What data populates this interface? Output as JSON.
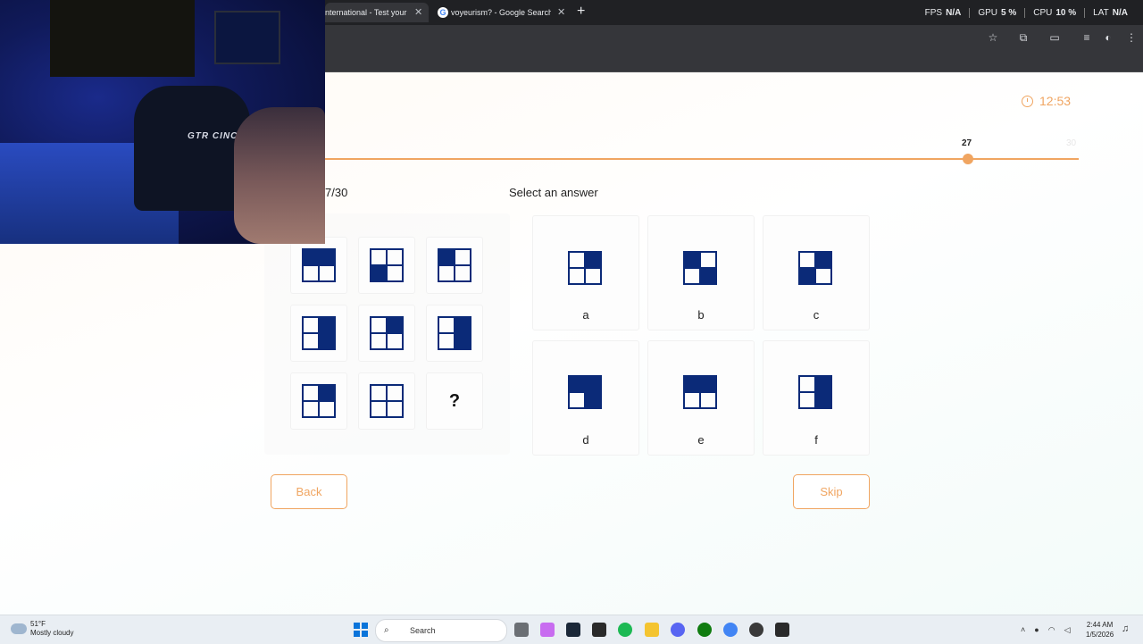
{
  "browser": {
    "tabs": [
      {
        "label": "nternational - Test your Inte",
        "active": true
      },
      {
        "label": "voyeurism? - Google Search",
        "active": false
      }
    ],
    "close_glyph": "✕",
    "new_tab_glyph": "+",
    "google_glyph": "G",
    "perf": [
      {
        "label": "FPS",
        "value": "N/A"
      },
      {
        "label": "GPU",
        "value": "5 %"
      },
      {
        "label": "CPU",
        "value": "10 %"
      },
      {
        "label": "LAT",
        "value": "N/A"
      }
    ],
    "toolbar_icons": [
      "star-icon",
      "extensions-icon",
      "cast-icon",
      "media-control-icon",
      "profile-icon",
      "more-icon"
    ]
  },
  "webcam": {
    "brand": "GTR CINC"
  },
  "quiz": {
    "timer": "12:53",
    "progress": {
      "current": "27",
      "total": "30",
      "fraction": 0.9
    },
    "question_counter": "7/30",
    "select_title": "Select an answer",
    "question_mark": "?",
    "matrix": [
      [
        "top",
        "bottom-left",
        "top-left"
      ],
      [
        "right",
        "top-right",
        "right"
      ],
      [
        "top-right",
        "none",
        null
      ]
    ],
    "answers": [
      {
        "label": "a",
        "fill": "top-right"
      },
      {
        "label": "b",
        "fill": "top-left,bottom-right"
      },
      {
        "label": "c",
        "fill": "top-right,bottom-left"
      },
      {
        "label": "d",
        "fill": "top,bottom-right"
      },
      {
        "label": "e",
        "fill": "top"
      },
      {
        "label": "f",
        "fill": "right"
      }
    ],
    "back_label": "Back",
    "skip_label": "Skip",
    "colors": {
      "accent": "#f0a561",
      "shape_fill": "#0b2a78"
    }
  },
  "taskbar": {
    "weather_temp": "51°F",
    "weather_desc": "Mostly cloudy",
    "search_label": "Search",
    "time": "2:44 AM",
    "date": "1/5/2026",
    "apps": [
      "file-explorer-icon",
      "copilot-icon",
      "steam-icon",
      "epic-games-icon",
      "spotify-icon",
      "folder-icon",
      "discord-icon",
      "xbox-icon",
      "chrome-icon",
      "obs-icon",
      "epic-launcher-icon"
    ]
  }
}
